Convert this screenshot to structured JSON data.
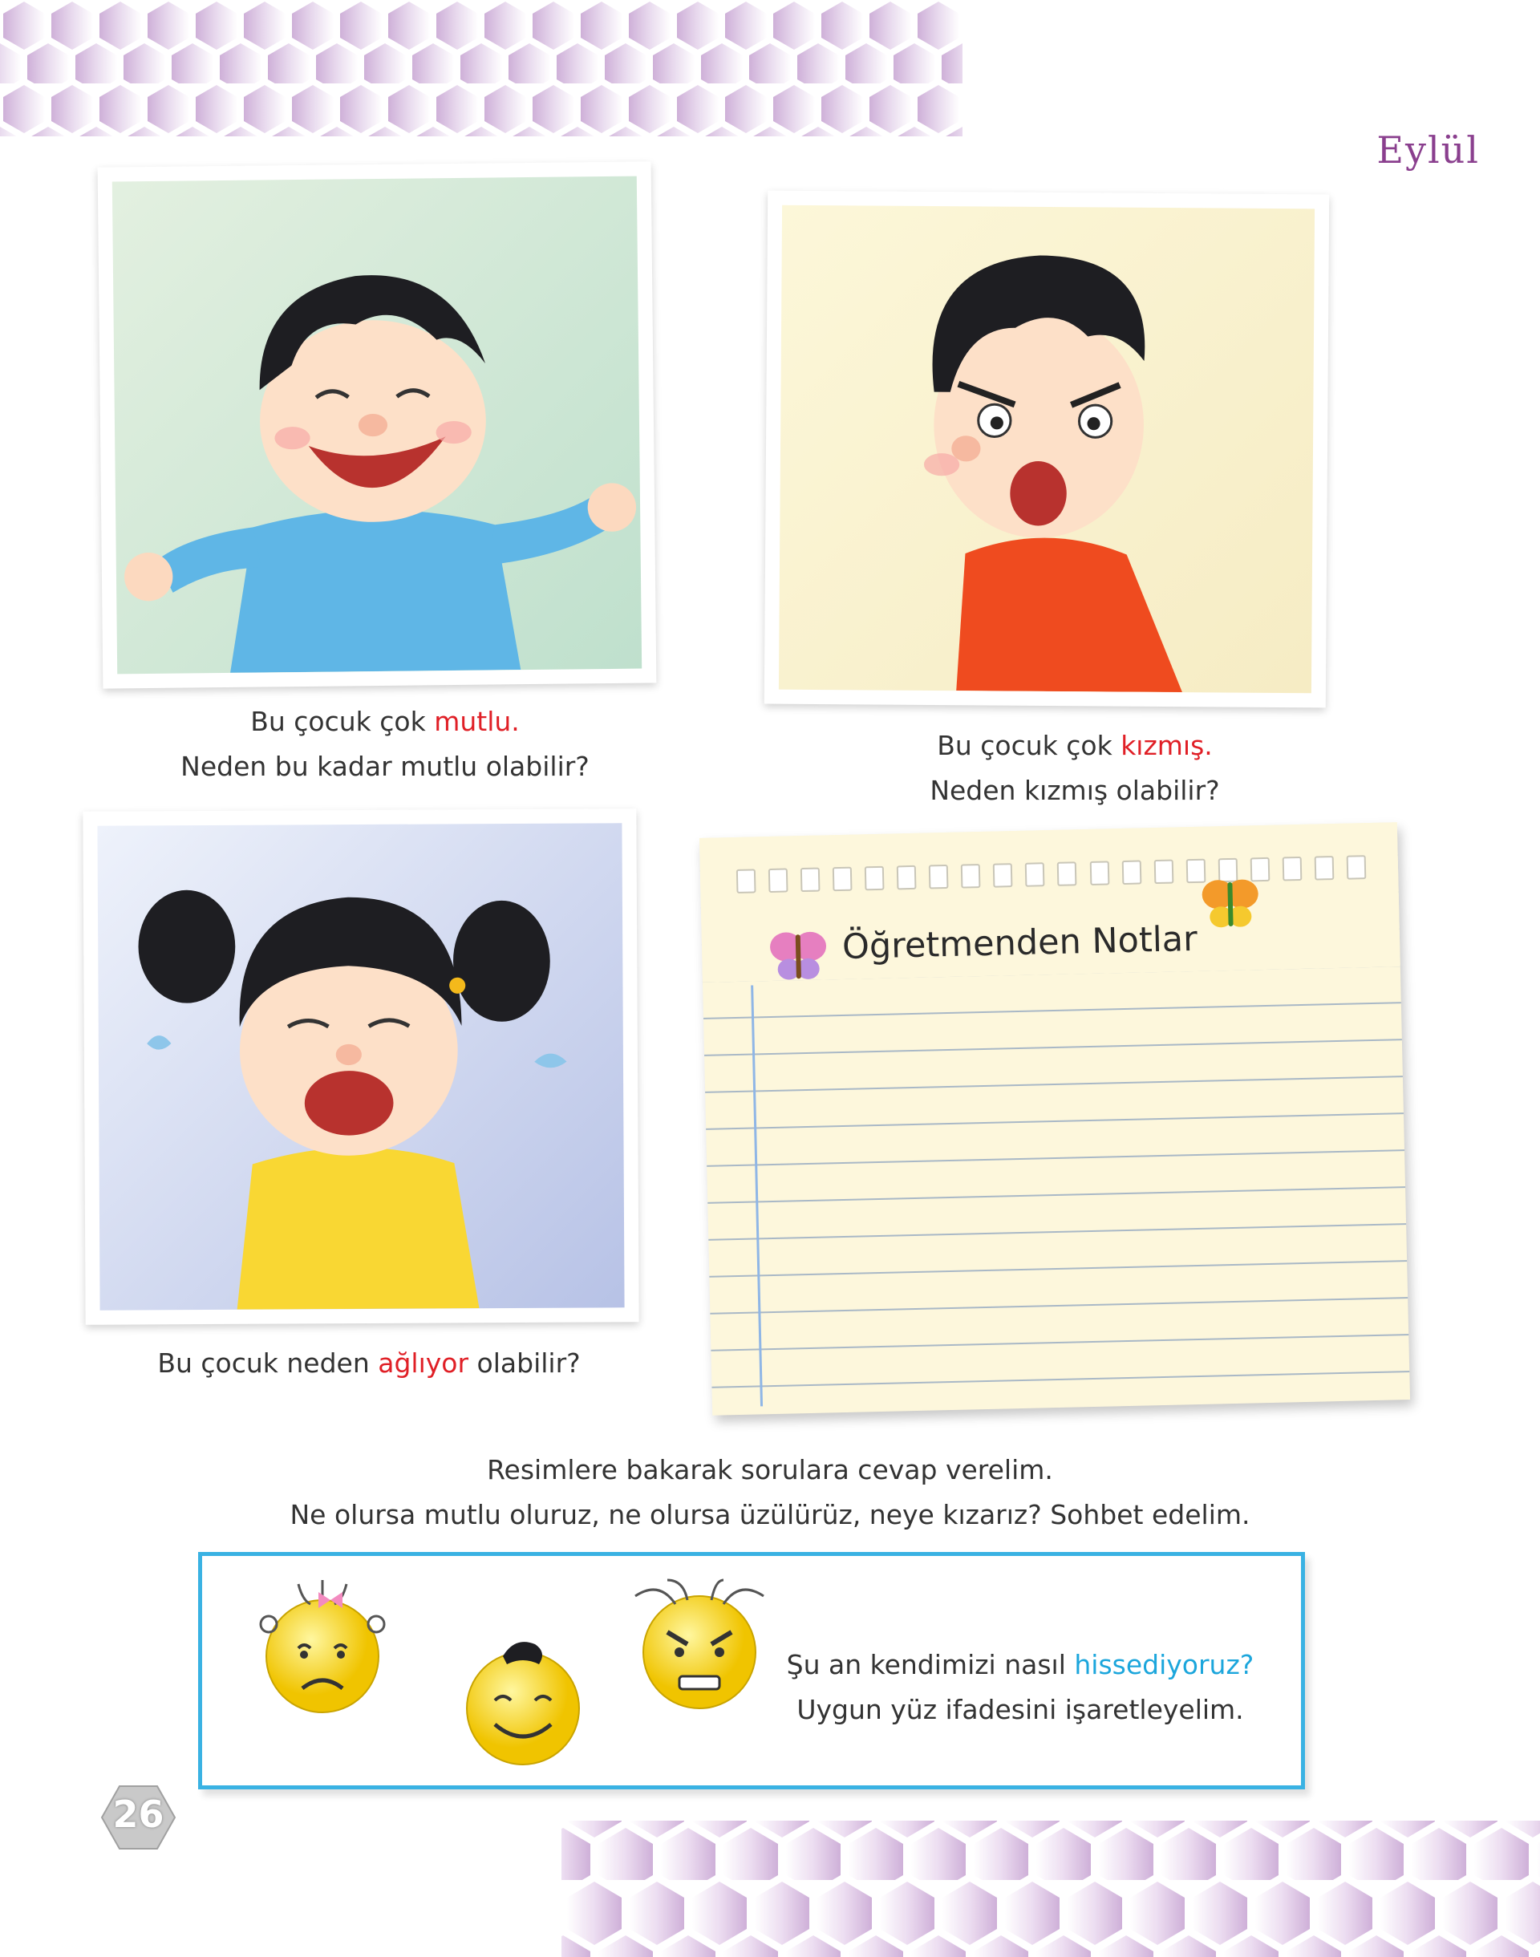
{
  "header": {
    "month": "Eylül"
  },
  "photos": [
    {
      "caption_line1_prefix": "Bu çocuk çok ",
      "caption_line1_highlight": "mutlu.",
      "caption_line2": "Neden bu kadar mutlu olabilir?"
    },
    {
      "caption_line1_prefix": "Bu çocuk çok ",
      "caption_line1_highlight": "kızmış.",
      "caption_line2": "Neden kızmış olabilir?"
    },
    {
      "caption_prefix": "Bu çocuk neden ",
      "caption_highlight": "ağlıyor",
      "caption_suffix": " olabilir?"
    }
  ],
  "notepad": {
    "title": "Öğretmenden Notlar"
  },
  "instructions": {
    "line1": "Resimlere bakarak sorulara cevap verelim.",
    "line2": "Ne olursa mutlu oluruz, ne olursa üzülürüz, neye kızarız? Sohbet edelim."
  },
  "mood_box": {
    "question_prefix": "Şu an kendimizi nasıl ",
    "question_highlight": "hissediyoruz?",
    "instruction": "Uygun yüz ifadesini işaretleyelim.",
    "faces": [
      "sad-face-icon",
      "happy-face-icon",
      "angry-face-icon"
    ]
  },
  "footer": {
    "page_number": "26"
  },
  "colors": {
    "highlight_red": "#e01f26",
    "highlight_blue": "#1ca6dc",
    "frame_blue": "#3ab2e3",
    "month_purple": "#8a3f8e"
  }
}
